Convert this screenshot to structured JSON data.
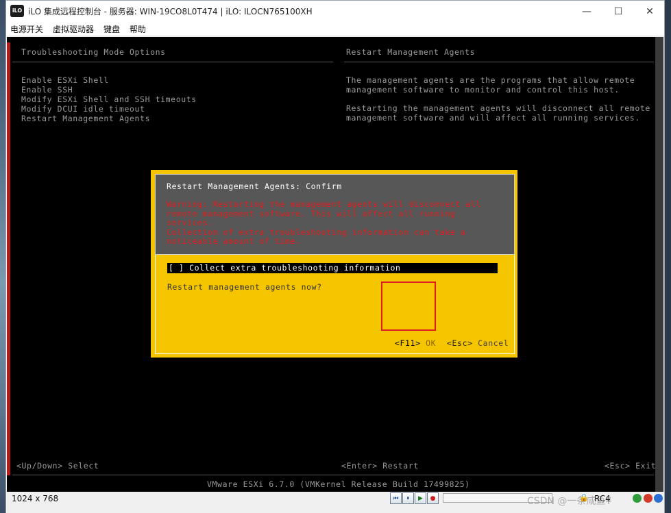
{
  "window": {
    "app_logo": "iLO",
    "title": "iLO 集成远程控制台 - 服务器: WIN-19CO8L0T474 | iLO: ILOCN765100XH",
    "controls": {
      "minimize": "—",
      "maximize": "☐",
      "close": "✕"
    }
  },
  "menu": {
    "items": [
      "电源开关",
      "虚拟驱动器",
      "键盘",
      "帮助"
    ]
  },
  "console": {
    "left_header": "Troubleshooting Mode Options",
    "right_header": "Restart Management Agents",
    "options": [
      "Enable ESXi Shell",
      "Enable SSH",
      "Modify ESXi Shell and SSH timeouts",
      "Modify DCUI idle timeout",
      "Restart Management Agents"
    ],
    "description_p1": "The management agents are the programs that allow remote\nmanagement software to monitor and control this host.",
    "description_p2": "Restarting the management agents will disconnect all remote\nmanagement software and will affect all running services.",
    "footer_left": "<Up/Down> Select",
    "footer_center": "<Enter> Restart",
    "footer_right": "<Esc> Exit",
    "build_line": "VMware ESXi 6.7.0 (VMKernel Release Build 17499825)"
  },
  "dialog": {
    "title": "Restart Management Agents: Confirm",
    "warning": "Warning: Restarting the management agents will disconnect all\nremote management software. This will affect all running\nservices.\nCollection of extra troubleshooting information can take a\nnoticeable amount of time.",
    "checkbox_label": "[ ] Collect extra troubleshooting information",
    "question": "Restart management agents now?",
    "ok_key": "<F11>",
    "ok_label": "OK",
    "cancel_key": "<Esc>",
    "cancel_label": "Cancel"
  },
  "status": {
    "resolution": "1024 x 768",
    "cipher": "RC4",
    "watermark": "CSDN @一条咸鱼¥",
    "colors": {
      "red_dot": "#d23b2b",
      "green_dot": "#2e9c3a",
      "blue_dot": "#2d6fd1"
    }
  },
  "colors": {
    "dialog_bg": "#f5c600",
    "dialog_header_bg": "#575757",
    "warning_text": "#e11d1d",
    "console_text": "#9a9a9a",
    "annotation_box": "#e02020"
  }
}
